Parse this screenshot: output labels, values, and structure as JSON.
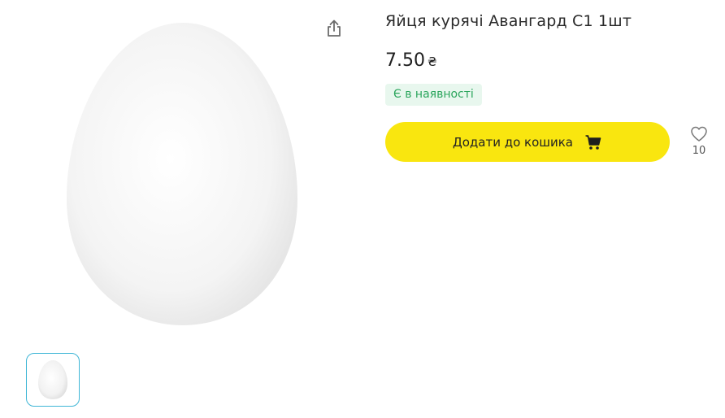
{
  "product": {
    "title": "Яйця курячі Авангард С1 1шт",
    "price": "7.50",
    "currency": "₴",
    "availability": "Є в наявності",
    "add_to_cart_label": "Додати до кошика",
    "favorites_count": "10"
  },
  "colors": {
    "accent_yellow": "#f9e60f",
    "in_stock_green": "#2aa55c",
    "thumb_border": "#3fb6d6"
  },
  "icons": {
    "share": "share-icon",
    "cart": "cart-icon",
    "favorite": "heart-icon"
  }
}
